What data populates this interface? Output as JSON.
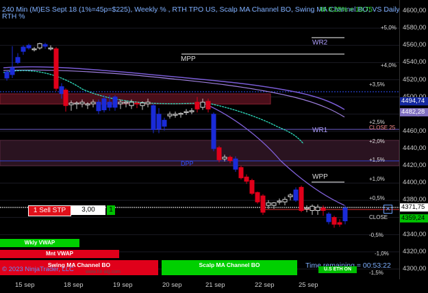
{
  "chart": {
    "title_line1": "240 Min (M)ES Sept 18 (1%=45p=$225), Weekly % , RTH TPO US, Scalp MA Channel BO, Swing MA Channel BO, VS Daily",
    "title_line2": "RTH %",
    "change_text": "W 0,25% = 10,75",
    "copyright": "© 2023 NinjaTrader, LLC",
    "website": "www.hit-alg.com"
  },
  "price_axis": {
    "labels": [
      "4600,00",
      "4580,00",
      "4560,00",
      "4540,00",
      "4520,00",
      "4500,00",
      "4480,00",
      "4460,00",
      "4440,00",
      "4420,00",
      "4400,00",
      "4380,00",
      "4360,00",
      "4340,00",
      "4320,00",
      "4300,00"
    ],
    "tag_blue": "4494,74",
    "tag_purple": "4482,28",
    "tag_white": "4371,75",
    "tag_green": "4359,24"
  },
  "date_axis": {
    "labels": [
      "15 sep",
      "18 sep",
      "19 sep",
      "20 sep",
      "21 sep",
      "22 sep",
      "25 sep"
    ]
  },
  "weekly_pct": [
    "+5,0%",
    "+4,0%",
    "+3,5%",
    "+2,5%",
    "+2,0%",
    "+1,5%",
    "+1,0%",
    "+0,5%",
    "-0,5%",
    "-1,0%",
    "-1,5%"
  ],
  "levels": {
    "mpp": "MPP",
    "wr2": "WR2",
    "wr1": "WR1",
    "wpp": "WPP",
    "close25": "CLOSE 25",
    "dpp": "DPP",
    "close": "CLOSE"
  },
  "order_bar": {
    "sell_label": "1 Sell STP",
    "price": "3,00",
    "qty": "1"
  },
  "bottom_panels": {
    "wkly_vwap": "Wkly VWAP",
    "mnt_vwap": "Mnt VWAP",
    "swing": "Swing MA Channel BO",
    "scalp": "Scalp MA Channel BO",
    "time_remaining": "Time remaining = 00:53:22",
    "us_eth_on": "U.S ETH ON"
  },
  "colors": {
    "bull": "#1a2bd8",
    "bear": "#e0001a",
    "fast_ma": "#2fe0c0",
    "slow_ma": "#7a5cd6",
    "price_blue": "#1428a0",
    "accent_green": "#00c000"
  }
}
